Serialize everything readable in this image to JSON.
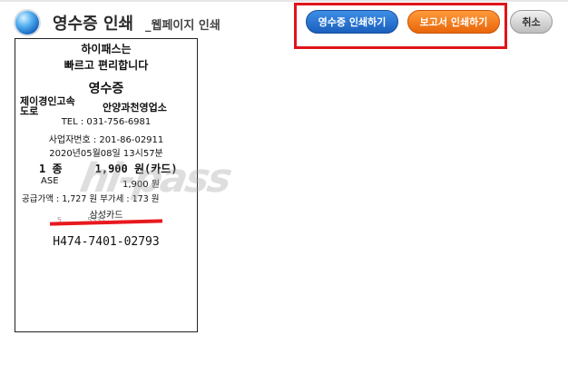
{
  "header": {
    "title": "영수증 인쇄",
    "subtitle": "_웹페이지 인쇄"
  },
  "buttons": {
    "print_receipt": "영수증 인쇄하기",
    "print_report": "보고서 인쇄하기",
    "cancel": "취소"
  },
  "receipt": {
    "line1": "하이패스는",
    "line2": "빠르고 편리합니다",
    "title": "영수증",
    "company": "제이경인고속도로",
    "office": "안양과천영업소",
    "tel": "TEL : 031-756-6981",
    "biz_no": "사업자번호 : 201-86-02911",
    "datetime": "2020년05월08일 13시57분",
    "class": "1 종",
    "amount": "1,900 원(카드)",
    "ase_label": "ASE",
    "ase_amount": "1,900 원",
    "supply": "공급가액 : 1,727 원    부가세 : 173 원",
    "card": "삼성카드",
    "card_number_redacted": "5... .. ....5331",
    "approval": "H474-7401-02793",
    "watermark": "hi-pass"
  },
  "colors": {
    "receipt_button": "#2a7ad6",
    "report_button": "#f27c1f",
    "highlight": "#e0141b",
    "redaction": "#e8191f"
  }
}
